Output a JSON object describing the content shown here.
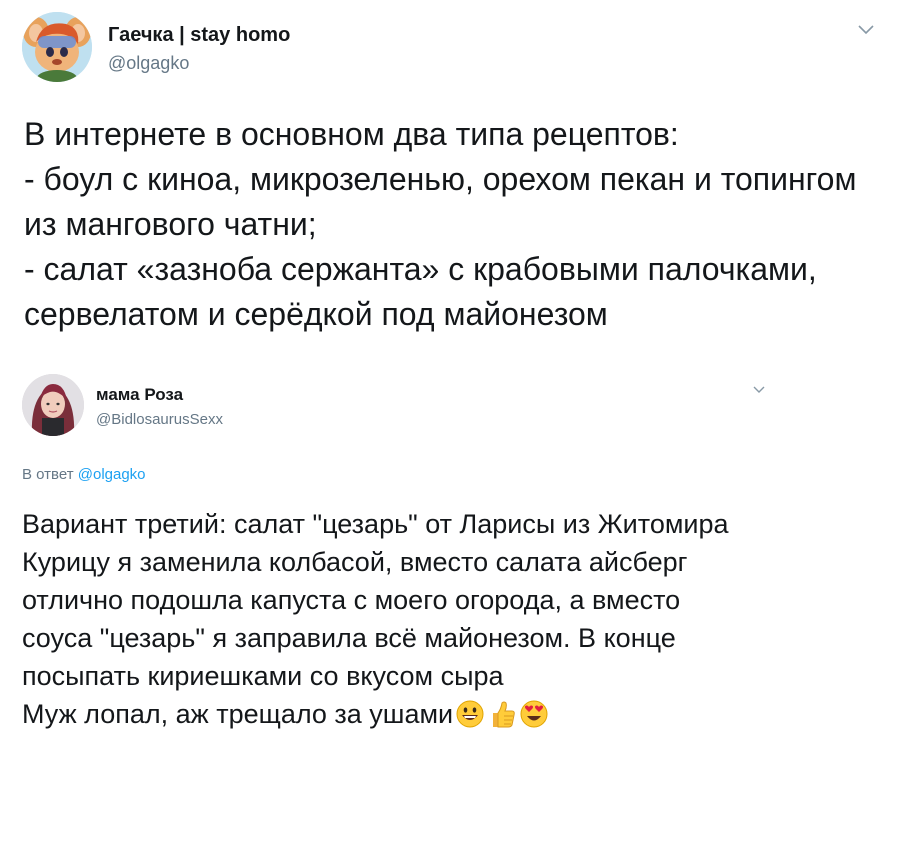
{
  "tweets": [
    {
      "display_name": "Гаечка | stay homo",
      "handle": "@olgagko",
      "avatar_icon": "cartoon-mouse-avatar-icon",
      "text": "В интернете в основном два типа рецептов:\n- боул с киноа, микрозеленью, орехом пекан и топингом из мангового чатни;\n- салат «зазноба сержанта» с крабовыми палочками, сервелатом и серёдкой под майонезом"
    },
    {
      "display_name": "мама Роза",
      "handle": "@BidlosaurusSexx",
      "avatar_icon": "user-photo-avatar-icon",
      "reply_prefix": "В ответ",
      "reply_to": "@olgagko",
      "text": "Вариант третий: салат \"цезарь\" от Ларисы из Житомира\nКурицу я заменила колбасой, вместо салата айсберг отлично подошла капуста с моего огорода, а вместо соуса \"цезарь\" я заправила всё майонезом. В конце посыпать кириешками со вкусом сыра\nМуж лопал, аж трещало за ушами",
      "emojis": [
        "smiley-emoji-icon",
        "thumbs-up-emoji-icon",
        "heart-eyes-emoji-icon"
      ]
    }
  ],
  "colors": {
    "text": "#14171a",
    "secondary": "#657786",
    "link": "#1da1f2"
  }
}
